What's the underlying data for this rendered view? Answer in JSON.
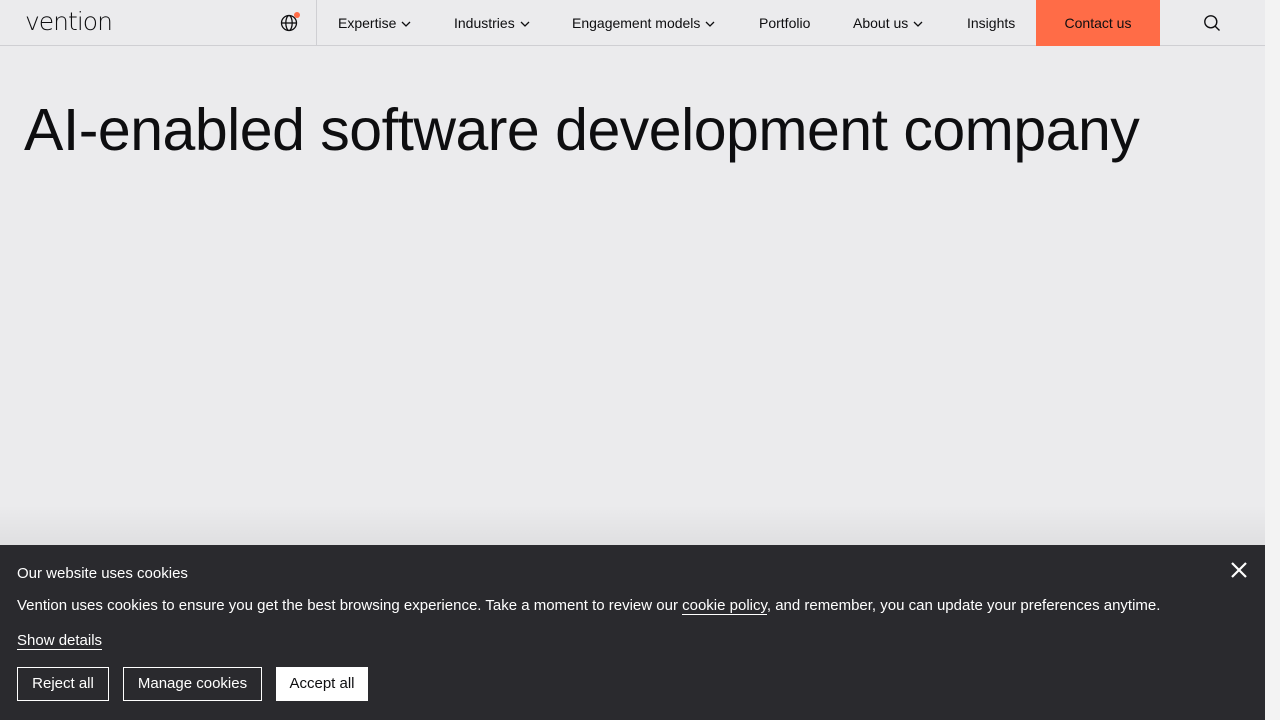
{
  "header": {
    "logo_text": "vention",
    "nav": [
      {
        "label": "Expertise",
        "dropdown": true
      },
      {
        "label": "Industries",
        "dropdown": true
      },
      {
        "label": "Engagement models",
        "dropdown": true
      },
      {
        "label": "Portfolio",
        "dropdown": false
      },
      {
        "label": "About us",
        "dropdown": true
      },
      {
        "label": "Insights",
        "dropdown": false
      }
    ],
    "contact_label": "Contact us",
    "icons": {
      "language": "globe-icon",
      "search": "search-icon"
    },
    "accent_color": "#ff6c47"
  },
  "hero": {
    "title": "AI-enabled software development company"
  },
  "cookie_banner": {
    "title": "Our website uses cookies",
    "text_before_link": "Vention uses cookies to ensure you get the best browsing experience. Take a moment to review our ",
    "link_label": "cookie policy",
    "text_after_link": ", and remember, you can update your preferences anytime.",
    "show_details_label": "Show details",
    "buttons": {
      "reject": "Reject all",
      "manage": "Manage cookies",
      "accept": "Accept all"
    },
    "background_color": "#2a2a2e"
  }
}
